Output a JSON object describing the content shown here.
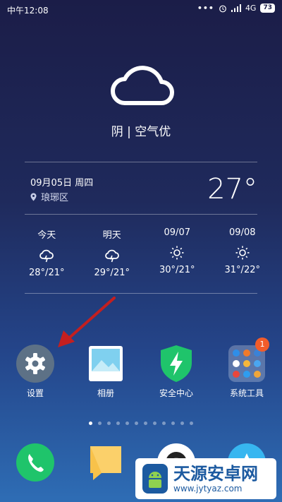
{
  "status": {
    "time": "中午12:08",
    "network": "4G",
    "battery": "73",
    "more": "•••"
  },
  "weather": {
    "condition": "阴 | 空气优",
    "date": "09月05日 周四",
    "location": "琅琊区",
    "temp": "27°",
    "forecast": [
      {
        "label": "今天",
        "range": "28°/21°",
        "icon": "thunder-cloud-icon"
      },
      {
        "label": "明天",
        "range": "29°/21°",
        "icon": "thunder-cloud-icon"
      },
      {
        "label": "09/07",
        "range": "30°/21°",
        "icon": "sun-icon"
      },
      {
        "label": "09/08",
        "range": "31°/22°",
        "icon": "sun-icon"
      }
    ]
  },
  "apps": [
    {
      "name": "设置",
      "icon": "gear-icon"
    },
    {
      "name": "相册",
      "icon": "gallery-icon"
    },
    {
      "name": "安全中心",
      "icon": "shield-bolt-icon"
    },
    {
      "name": "系统工具",
      "icon": "folder-icon",
      "badge": "1"
    }
  ],
  "dock": [
    "phone-icon",
    "message-icon",
    "camera-icon",
    "browser-icon"
  ],
  "watermark": {
    "title": "天源安卓网",
    "url": "www.jytyaz.com"
  },
  "colors": {
    "accent_green": "#1fc46b",
    "badge": "#f25c2a",
    "settings_tile": "#5d7186",
    "arrow": "#c41f1f"
  }
}
